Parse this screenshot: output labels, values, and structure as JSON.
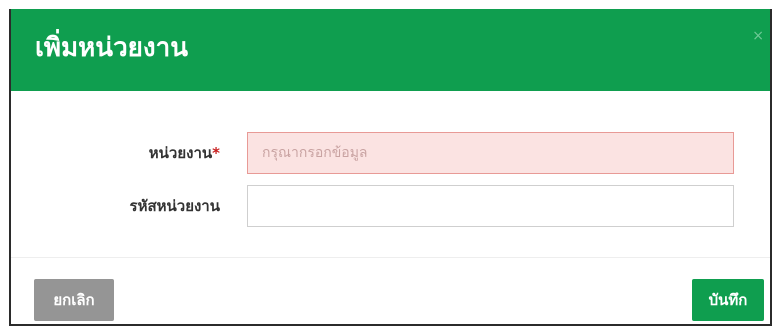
{
  "modal": {
    "title": "เพิ่มหน่วยงาน",
    "close_label": "×"
  },
  "form": {
    "fields": [
      {
        "label": "หน่วยงาน",
        "required_mark": "*",
        "value": "",
        "placeholder": "กรุณากรอกข้อมูล",
        "state": "error"
      },
      {
        "label": "รหัสหน่วยงาน",
        "value": "",
        "placeholder": ""
      }
    ]
  },
  "footer": {
    "cancel_label": "ยกเลิก",
    "save_label": "บันทึก"
  },
  "colors": {
    "header_bg": "#0f9e4f",
    "save_button_bg": "#0f9e4f",
    "cancel_button_bg": "#959595",
    "error_input_bg": "#fbe3e2",
    "error_input_border": "#e89a96",
    "required_mark": "#c81e1e"
  }
}
